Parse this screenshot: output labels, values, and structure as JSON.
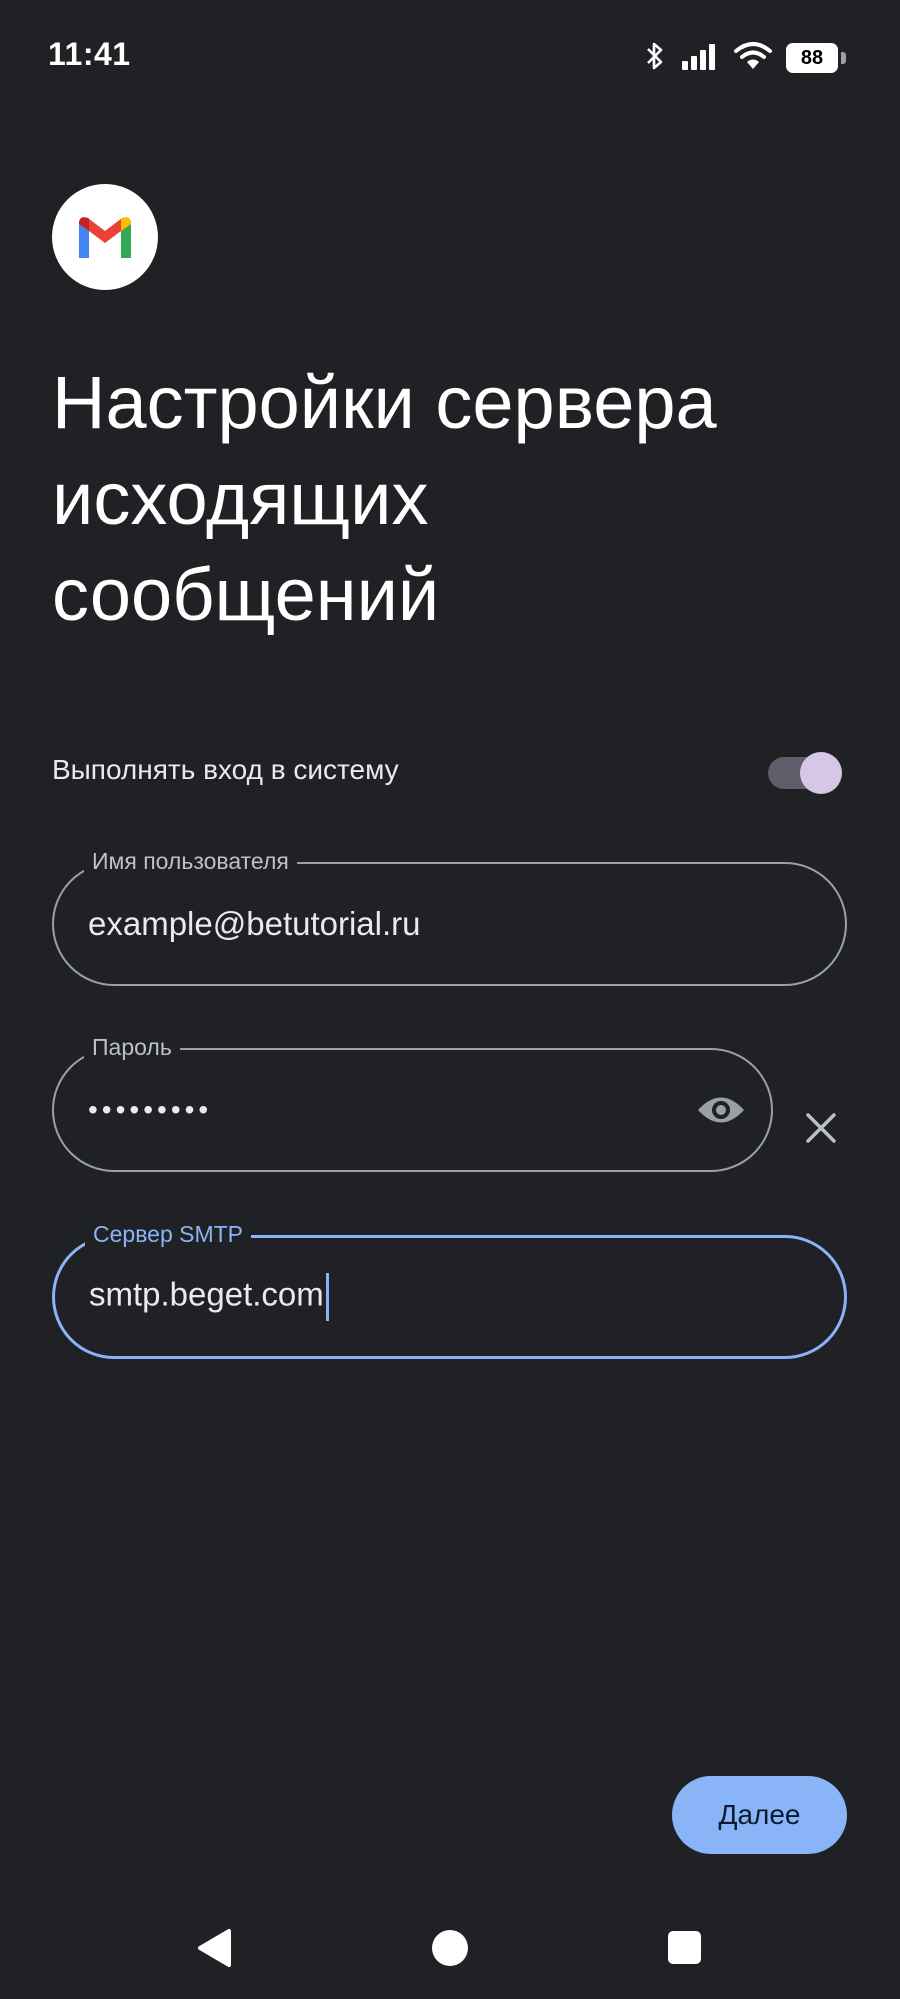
{
  "status_bar": {
    "time": "11:41",
    "battery": "88",
    "icons": [
      "bluetooth-icon",
      "signal-icon",
      "wifi-icon",
      "battery-icon"
    ]
  },
  "app": {
    "logo_icon": "gmail-logo-icon"
  },
  "page": {
    "title_lines": [
      "Настройки сервера",
      "исходящих",
      "сообщений"
    ]
  },
  "login_toggle": {
    "label": "Выполнять вход в систему",
    "on": true
  },
  "fields": {
    "username": {
      "label": "Имя пользователя",
      "value": "example@betutorial.ru"
    },
    "password": {
      "label": "Пароль",
      "value": "•••••••••"
    },
    "smtp": {
      "label": "Сервер SMTP",
      "value": "smtp.beget.com"
    }
  },
  "actions": {
    "next_label": "Далее"
  },
  "colors": {
    "background": "#202124",
    "accent": "#8ab4f8",
    "toggle_thumb": "#d6c7e6"
  },
  "nav": {
    "icons": [
      "back-icon",
      "home-icon",
      "recents-icon"
    ]
  }
}
